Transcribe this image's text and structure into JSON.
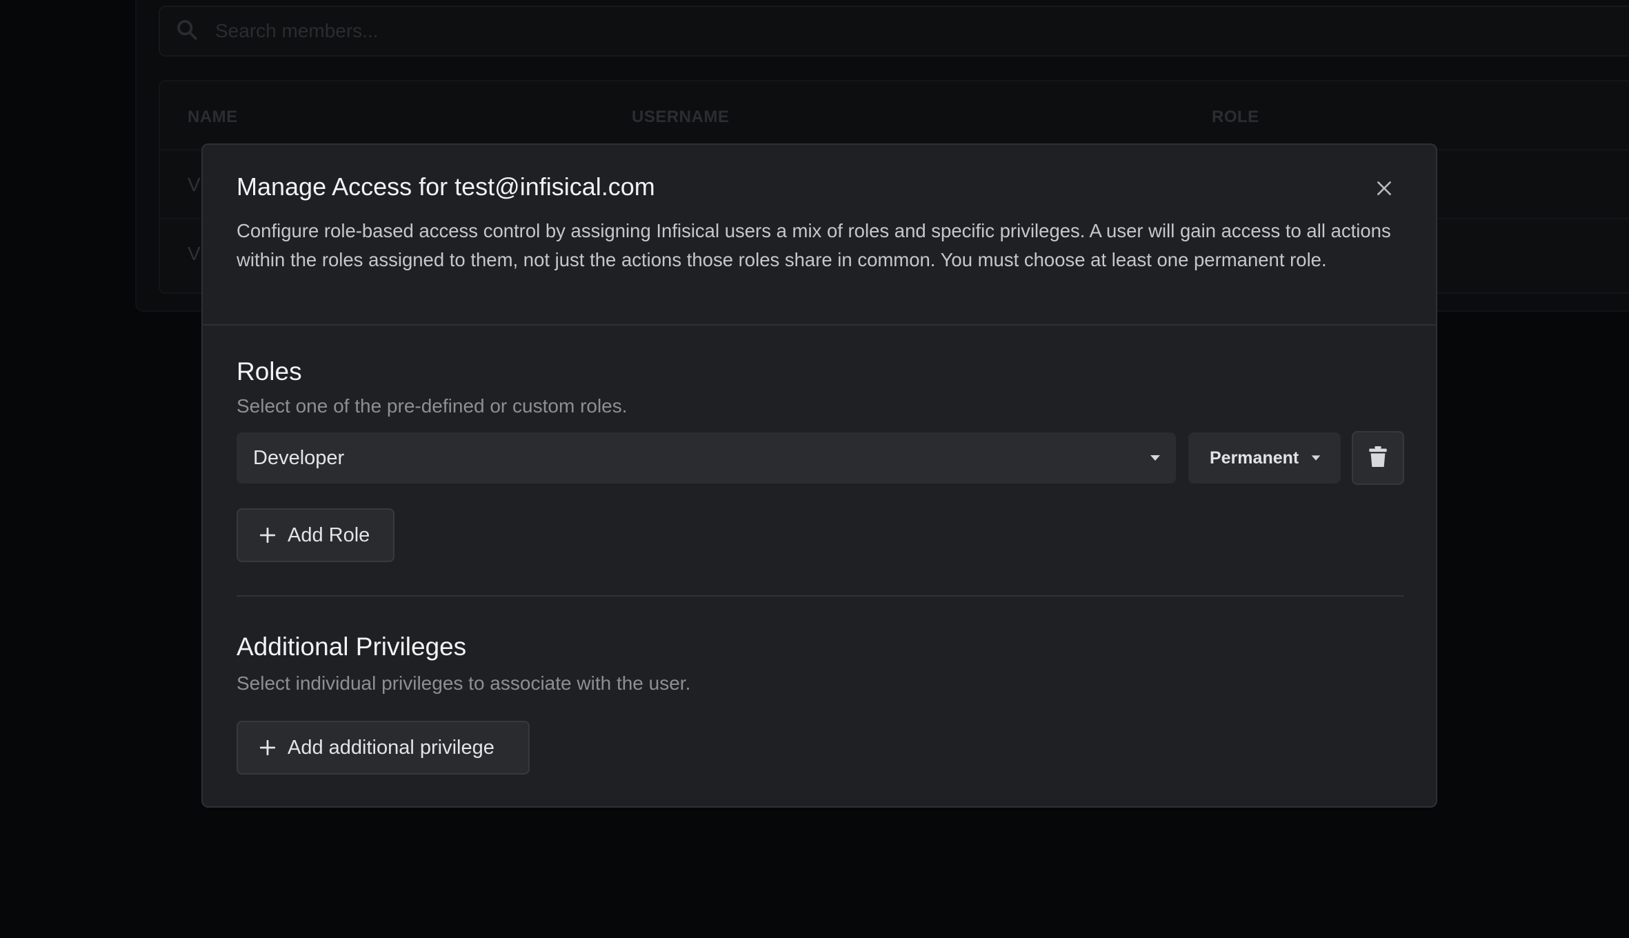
{
  "background": {
    "search": {
      "placeholder": "Search members..."
    },
    "table": {
      "columns": [
        "NAME",
        "USERNAME",
        "ROLE"
      ],
      "rows": [
        {
          "name_visible": "V"
        },
        {
          "name_visible": "V"
        }
      ]
    }
  },
  "modal": {
    "title": "Manage Access for test@infisical.com",
    "description": "Configure role-based access control by assigning Infisical users a mix of roles and specific privileges. A user will gain access to all actions within the roles assigned to them, not just the actions those roles share in common. You must choose at least one permanent role.",
    "close_icon": "close-icon",
    "roles": {
      "title": "Roles",
      "subtitle": "Select one of the pre-defined or custom roles.",
      "selected_role": "Developer",
      "duration": "Permanent",
      "delete_icon": "trash-icon",
      "add_label": "Add Role"
    },
    "privileges": {
      "title": "Additional Privileges",
      "subtitle": "Select individual privileges to associate with the user.",
      "add_label": "Add additional privilege"
    }
  }
}
